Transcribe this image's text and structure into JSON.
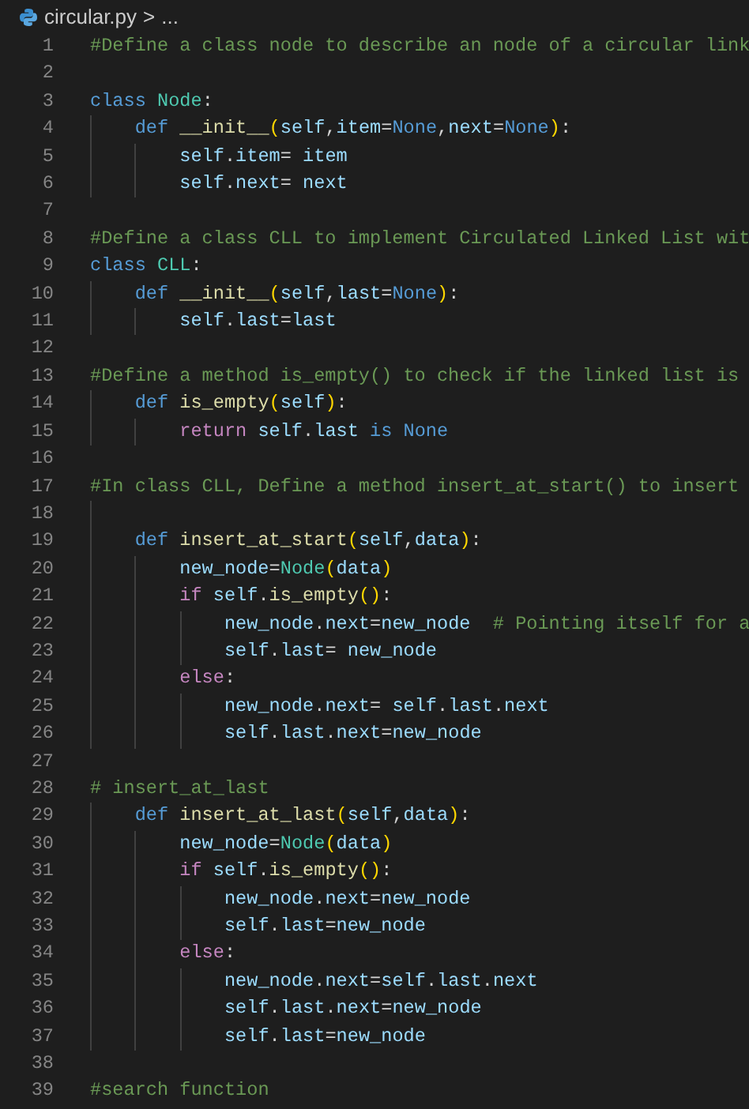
{
  "breadcrumb": {
    "file": "circular.py",
    "separator": ">",
    "rest": "..."
  },
  "lines": [
    {
      "number": "1",
      "tokens": [
        {
          "text": "#Define a class node to describe an node of a circular link",
          "kind": "comment"
        }
      ]
    },
    {
      "number": "2"
    },
    {
      "number": "3",
      "tokens": [
        {
          "text": "class ",
          "kind": "keyword"
        },
        {
          "text": "Node",
          "kind": "class"
        },
        {
          "text": ":",
          "kind": "plain"
        }
      ],
      "children": [
        {
          "number": "4",
          "tokens": [
            {
              "text": "def ",
              "kind": "keyword"
            },
            {
              "text": "__init__",
              "kind": "function"
            },
            {
              "text": "(",
              "kind": "bracket"
            },
            {
              "text": "self",
              "kind": "variable"
            },
            {
              "text": ",",
              "kind": "plain"
            },
            {
              "text": "item",
              "kind": "variable"
            },
            {
              "text": "=",
              "kind": "plain"
            },
            {
              "text": "None",
              "kind": "constant"
            },
            {
              "text": ",",
              "kind": "plain"
            },
            {
              "text": "next",
              "kind": "variable"
            },
            {
              "text": "=",
              "kind": "plain"
            },
            {
              "text": "None",
              "kind": "constant"
            },
            {
              "text": ")",
              "kind": "bracket"
            },
            {
              "text": ":",
              "kind": "plain"
            }
          ],
          "children": [
            {
              "number": "5",
              "tokens": [
                {
                  "text": "self",
                  "kind": "variable"
                },
                {
                  "text": ".",
                  "kind": "plain"
                },
                {
                  "text": "item",
                  "kind": "variable"
                },
                {
                  "text": "= ",
                  "kind": "plain"
                },
                {
                  "text": "item",
                  "kind": "variable"
                }
              ]
            },
            {
              "number": "6",
              "tokens": [
                {
                  "text": "self",
                  "kind": "variable"
                },
                {
                  "text": ".",
                  "kind": "plain"
                },
                {
                  "text": "next",
                  "kind": "variable"
                },
                {
                  "text": "= ",
                  "kind": "plain"
                },
                {
                  "text": "next",
                  "kind": "variable"
                }
              ]
            }
          ]
        }
      ]
    },
    {
      "number": "7"
    },
    {
      "number": "8",
      "tokens": [
        {
          "text": "#Define a class CLL to implement Circulated Linked List wit",
          "kind": "comment"
        }
      ]
    },
    {
      "number": "9",
      "tokens": [
        {
          "text": "class ",
          "kind": "keyword"
        },
        {
          "text": "CLL",
          "kind": "class"
        },
        {
          "text": ":",
          "kind": "plain"
        }
      ],
      "children": [
        {
          "number": "10",
          "tokens": [
            {
              "text": "def ",
              "kind": "keyword"
            },
            {
              "text": "__init__",
              "kind": "function"
            },
            {
              "text": "(",
              "kind": "bracket"
            },
            {
              "text": "self",
              "kind": "variable"
            },
            {
              "text": ",",
              "kind": "plain"
            },
            {
              "text": "last",
              "kind": "variable"
            },
            {
              "text": "=",
              "kind": "plain"
            },
            {
              "text": "None",
              "kind": "constant"
            },
            {
              "text": ")",
              "kind": "bracket"
            },
            {
              "text": ":",
              "kind": "plain"
            }
          ],
          "children": [
            {
              "number": "11",
              "tokens": [
                {
                  "text": "self",
                  "kind": "variable"
                },
                {
                  "text": ".",
                  "kind": "plain"
                },
                {
                  "text": "last",
                  "kind": "variable"
                },
                {
                  "text": "=",
                  "kind": "plain"
                },
                {
                  "text": "last",
                  "kind": "variable"
                }
              ]
            }
          ]
        }
      ]
    },
    {
      "number": "12"
    },
    {
      "number": "13",
      "tokens": [
        {
          "text": "#Define a method is_empty() to check if the linked list is",
          "kind": "comment"
        }
      ],
      "children": [
        {
          "number": "14",
          "tokens": [
            {
              "text": "def ",
              "kind": "keyword"
            },
            {
              "text": "is_empty",
              "kind": "function"
            },
            {
              "text": "(",
              "kind": "bracket"
            },
            {
              "text": "self",
              "kind": "variable"
            },
            {
              "text": ")",
              "kind": "bracket"
            },
            {
              "text": ":",
              "kind": "plain"
            }
          ],
          "children": [
            {
              "number": "15",
              "tokens": [
                {
                  "text": "return ",
                  "kind": "control"
                },
                {
                  "text": "self",
                  "kind": "variable"
                },
                {
                  "text": ".",
                  "kind": "plain"
                },
                {
                  "text": "last ",
                  "kind": "variable"
                },
                {
                  "text": "is ",
                  "kind": "keyword"
                },
                {
                  "text": "None",
                  "kind": "constant"
                }
              ]
            }
          ]
        }
      ]
    },
    {
      "number": "16"
    },
    {
      "number": "17",
      "tokens": [
        {
          "text": "#In class CLL, Define a method insert_at_start() to insert",
          "kind": "comment"
        }
      ],
      "children": [
        {
          "number": "18"
        },
        {
          "number": "19",
          "tokens": [
            {
              "text": "def ",
              "kind": "keyword"
            },
            {
              "text": "insert_at_start",
              "kind": "function"
            },
            {
              "text": "(",
              "kind": "bracket"
            },
            {
              "text": "self",
              "kind": "variable"
            },
            {
              "text": ",",
              "kind": "plain"
            },
            {
              "text": "data",
              "kind": "variable"
            },
            {
              "text": ")",
              "kind": "bracket"
            },
            {
              "text": ":",
              "kind": "plain"
            }
          ],
          "children": [
            {
              "number": "20",
              "tokens": [
                {
                  "text": "new_node",
                  "kind": "variable"
                },
                {
                  "text": "=",
                  "kind": "plain"
                },
                {
                  "text": "Node",
                  "kind": "class"
                },
                {
                  "text": "(",
                  "kind": "bracket"
                },
                {
                  "text": "data",
                  "kind": "variable"
                },
                {
                  "text": ")",
                  "kind": "bracket"
                }
              ]
            },
            {
              "number": "21",
              "tokens": [
                {
                  "text": "if ",
                  "kind": "control"
                },
                {
                  "text": "self",
                  "kind": "variable"
                },
                {
                  "text": ".",
                  "kind": "plain"
                },
                {
                  "text": "is_empty",
                  "kind": "function"
                },
                {
                  "text": "()",
                  "kind": "bracket"
                },
                {
                  "text": ":",
                  "kind": "plain"
                }
              ],
              "children": [
                {
                  "number": "22",
                  "tokens": [
                    {
                      "text": "new_node",
                      "kind": "variable"
                    },
                    {
                      "text": ".",
                      "kind": "plain"
                    },
                    {
                      "text": "next",
                      "kind": "variable"
                    },
                    {
                      "text": "=",
                      "kind": "plain"
                    },
                    {
                      "text": "new_node",
                      "kind": "variable"
                    },
                    {
                      "text": "  # Pointing itself for a",
                      "kind": "comment"
                    }
                  ]
                },
                {
                  "number": "23",
                  "tokens": [
                    {
                      "text": "self",
                      "kind": "variable"
                    },
                    {
                      "text": ".",
                      "kind": "plain"
                    },
                    {
                      "text": "last",
                      "kind": "variable"
                    },
                    {
                      "text": "= ",
                      "kind": "plain"
                    },
                    {
                      "text": "new_node",
                      "kind": "variable"
                    }
                  ]
                }
              ]
            },
            {
              "number": "24",
              "tokens": [
                {
                  "text": "else",
                  "kind": "control"
                },
                {
                  "text": ":",
                  "kind": "plain"
                }
              ],
              "children": [
                {
                  "number": "25",
                  "tokens": [
                    {
                      "text": "new_node",
                      "kind": "variable"
                    },
                    {
                      "text": ".",
                      "kind": "plain"
                    },
                    {
                      "text": "next",
                      "kind": "variable"
                    },
                    {
                      "text": "= ",
                      "kind": "plain"
                    },
                    {
                      "text": "self",
                      "kind": "variable"
                    },
                    {
                      "text": ".",
                      "kind": "plain"
                    },
                    {
                      "text": "last",
                      "kind": "variable"
                    },
                    {
                      "text": ".",
                      "kind": "plain"
                    },
                    {
                      "text": "next",
                      "kind": "variable"
                    }
                  ]
                },
                {
                  "number": "26",
                  "tokens": [
                    {
                      "text": "self",
                      "kind": "variable"
                    },
                    {
                      "text": ".",
                      "kind": "plain"
                    },
                    {
                      "text": "last",
                      "kind": "variable"
                    },
                    {
                      "text": ".",
                      "kind": "plain"
                    },
                    {
                      "text": "next",
                      "kind": "variable"
                    },
                    {
                      "text": "=",
                      "kind": "plain"
                    },
                    {
                      "text": "new_node",
                      "kind": "variable"
                    }
                  ]
                }
              ]
            }
          ]
        }
      ]
    },
    {
      "number": "27"
    },
    {
      "number": "28",
      "tokens": [
        {
          "text": "# insert_at_last",
          "kind": "comment"
        }
      ],
      "children": [
        {
          "number": "29",
          "tokens": [
            {
              "text": "def ",
              "kind": "keyword"
            },
            {
              "text": "insert_at_last",
              "kind": "function"
            },
            {
              "text": "(",
              "kind": "bracket"
            },
            {
              "text": "self",
              "kind": "variable"
            },
            {
              "text": ",",
              "kind": "plain"
            },
            {
              "text": "data",
              "kind": "variable"
            },
            {
              "text": ")",
              "kind": "bracket"
            },
            {
              "text": ":",
              "kind": "plain"
            }
          ],
          "children": [
            {
              "number": "30",
              "tokens": [
                {
                  "text": "new_node",
                  "kind": "variable"
                },
                {
                  "text": "=",
                  "kind": "plain"
                },
                {
                  "text": "Node",
                  "kind": "class"
                },
                {
                  "text": "(",
                  "kind": "bracket"
                },
                {
                  "text": "data",
                  "kind": "variable"
                },
                {
                  "text": ")",
                  "kind": "bracket"
                }
              ]
            },
            {
              "number": "31",
              "tokens": [
                {
                  "text": "if ",
                  "kind": "control"
                },
                {
                  "text": "self",
                  "kind": "variable"
                },
                {
                  "text": ".",
                  "kind": "plain"
                },
                {
                  "text": "is_empty",
                  "kind": "function"
                },
                {
                  "text": "()",
                  "kind": "bracket"
                },
                {
                  "text": ":",
                  "kind": "plain"
                }
              ],
              "children": [
                {
                  "number": "32",
                  "tokens": [
                    {
                      "text": "new_node",
                      "kind": "variable"
                    },
                    {
                      "text": ".",
                      "kind": "plain"
                    },
                    {
                      "text": "next",
                      "kind": "variable"
                    },
                    {
                      "text": "=",
                      "kind": "plain"
                    },
                    {
                      "text": "new_node",
                      "kind": "variable"
                    }
                  ]
                },
                {
                  "number": "33",
                  "tokens": [
                    {
                      "text": "self",
                      "kind": "variable"
                    },
                    {
                      "text": ".",
                      "kind": "plain"
                    },
                    {
                      "text": "last",
                      "kind": "variable"
                    },
                    {
                      "text": "=",
                      "kind": "plain"
                    },
                    {
                      "text": "new_node",
                      "kind": "variable"
                    }
                  ]
                }
              ]
            },
            {
              "number": "34",
              "tokens": [
                {
                  "text": "else",
                  "kind": "control"
                },
                {
                  "text": ":",
                  "kind": "plain"
                }
              ],
              "children": [
                {
                  "number": "35",
                  "tokens": [
                    {
                      "text": "new_node",
                      "kind": "variable"
                    },
                    {
                      "text": ".",
                      "kind": "plain"
                    },
                    {
                      "text": "next",
                      "kind": "variable"
                    },
                    {
                      "text": "=",
                      "kind": "plain"
                    },
                    {
                      "text": "self",
                      "kind": "variable"
                    },
                    {
                      "text": ".",
                      "kind": "plain"
                    },
                    {
                      "text": "last",
                      "kind": "variable"
                    },
                    {
                      "text": ".",
                      "kind": "plain"
                    },
                    {
                      "text": "next",
                      "kind": "variable"
                    }
                  ]
                },
                {
                  "number": "36",
                  "tokens": [
                    {
                      "text": "self",
                      "kind": "variable"
                    },
                    {
                      "text": ".",
                      "kind": "plain"
                    },
                    {
                      "text": "last",
                      "kind": "variable"
                    },
                    {
                      "text": ".",
                      "kind": "plain"
                    },
                    {
                      "text": "next",
                      "kind": "variable"
                    },
                    {
                      "text": "=",
                      "kind": "plain"
                    },
                    {
                      "text": "new_node",
                      "kind": "variable"
                    }
                  ]
                },
                {
                  "number": "37",
                  "tokens": [
                    {
                      "text": "self",
                      "kind": "variable"
                    },
                    {
                      "text": ".",
                      "kind": "plain"
                    },
                    {
                      "text": "last",
                      "kind": "variable"
                    },
                    {
                      "text": "=",
                      "kind": "plain"
                    },
                    {
                      "text": "new_node",
                      "kind": "variable"
                    }
                  ]
                }
              ]
            }
          ]
        }
      ]
    },
    {
      "number": "38"
    },
    {
      "number": "39",
      "tokens": [
        {
          "text": "#search function",
          "kind": "comment"
        }
      ]
    }
  ]
}
